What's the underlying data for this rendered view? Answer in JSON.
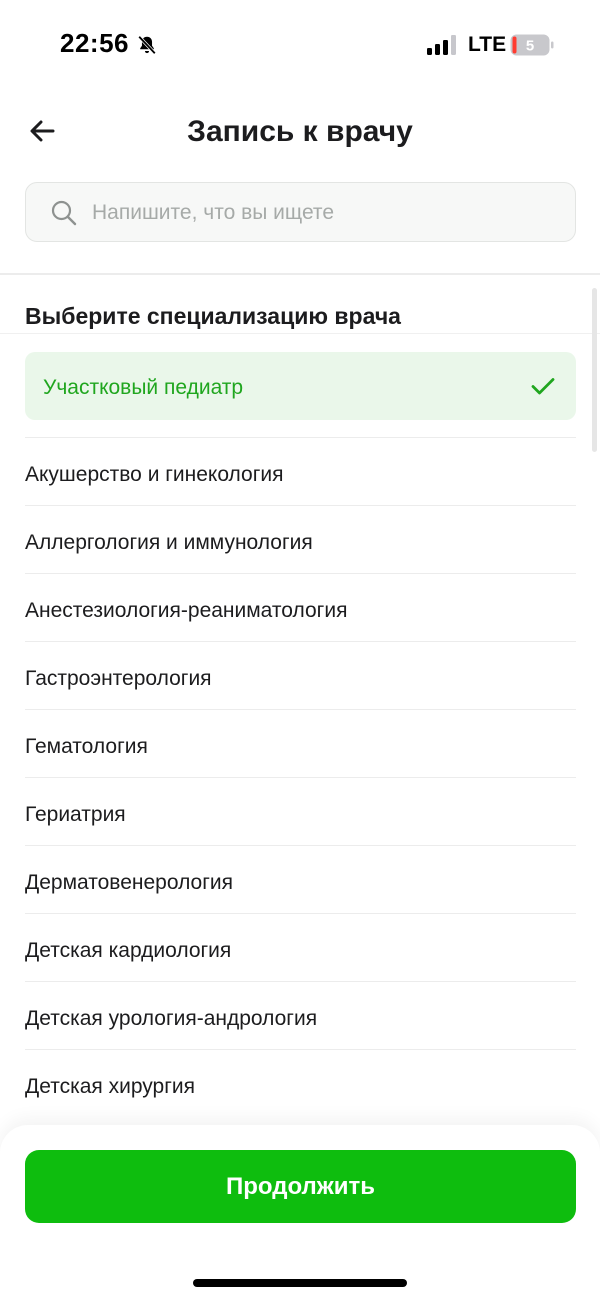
{
  "status_bar": {
    "time": "22:56",
    "network": "LTE",
    "battery_level": "5",
    "icons": [
      "bell-off-icon",
      "signal-icon",
      "battery-icon"
    ]
  },
  "header": {
    "title": "Запись к врачу",
    "back_icon": "arrow-left-icon"
  },
  "search": {
    "placeholder": "Напишите, что вы ищете",
    "value": ""
  },
  "section": {
    "title": "Выберите специализацию врача"
  },
  "selected": {
    "label": "Участковый педиатр",
    "icon": "check-icon"
  },
  "specializations": [
    "Акушерство и гинекология",
    "Аллергология и иммунология",
    "Анестезиология-реаниматология",
    "Гастроэнтерология",
    "Гематология",
    "Гериатрия",
    "Дерматовенерология",
    "Детская кардиология",
    "Детская урология-андрология",
    "Детская хирургия"
  ],
  "footer": {
    "continue_label": "Продолжить"
  },
  "colors": {
    "accent": "#0ebd0e",
    "selected_bg": "#eaf7ea",
    "selected_text": "#20a61f"
  }
}
